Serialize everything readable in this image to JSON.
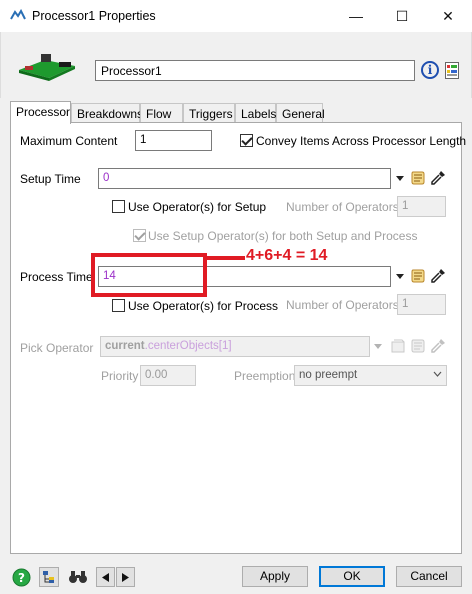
{
  "window": {
    "title": "Processor1  Properties",
    "controls": {
      "minimize": "—",
      "maximize": "☐",
      "close": "✕"
    }
  },
  "header": {
    "object_name": "Processor1",
    "info_symbol": "i"
  },
  "tabs": [
    {
      "label": "Processor",
      "active": true
    },
    {
      "label": "Breakdowns",
      "active": false
    },
    {
      "label": "Flow",
      "active": false
    },
    {
      "label": "Triggers",
      "active": false
    },
    {
      "label": "Labels",
      "active": false
    },
    {
      "label": "General",
      "active": false
    }
  ],
  "processor": {
    "max_content_label": "Maximum Content",
    "max_content_value": "1",
    "convey_label": "Convey Items Across Processor Length",
    "convey_checked": true,
    "setup_time_label": "Setup Time",
    "setup_time_value": "0",
    "use_operators_setup_label": "Use Operator(s) for Setup",
    "use_operators_setup_checked": false,
    "setup_num_operators_label": "Number of Operators",
    "setup_num_operators_value": "1",
    "use_setup_both_label": "Use Setup Operator(s) for both Setup and Process",
    "use_setup_both_checked": true,
    "process_time_label": "Process Time",
    "process_time_value": "14",
    "use_operators_process_label": "Use Operator(s) for Process",
    "use_operators_process_checked": false,
    "process_num_operators_label": "Number of Operators",
    "process_num_operators_value": "1",
    "pick_operator_label": "Pick Operator",
    "pick_operator_keyword": "current",
    "pick_operator_rest": ".centerObjects[1]",
    "priority_label": "Priority",
    "priority_value": "0.00",
    "preemption_label": "Preemption",
    "preemption_value": "no preempt"
  },
  "annotation": {
    "text": "4+6+4 = 14",
    "color": "#e01b24"
  },
  "footer": {
    "apply_label": "Apply",
    "ok_label": "OK",
    "cancel_label": "Cancel"
  },
  "colors": {
    "code_purple": "#9b30c8",
    "keyword_gray": "#a0a0a0",
    "accent_blue": "#0078d7"
  }
}
